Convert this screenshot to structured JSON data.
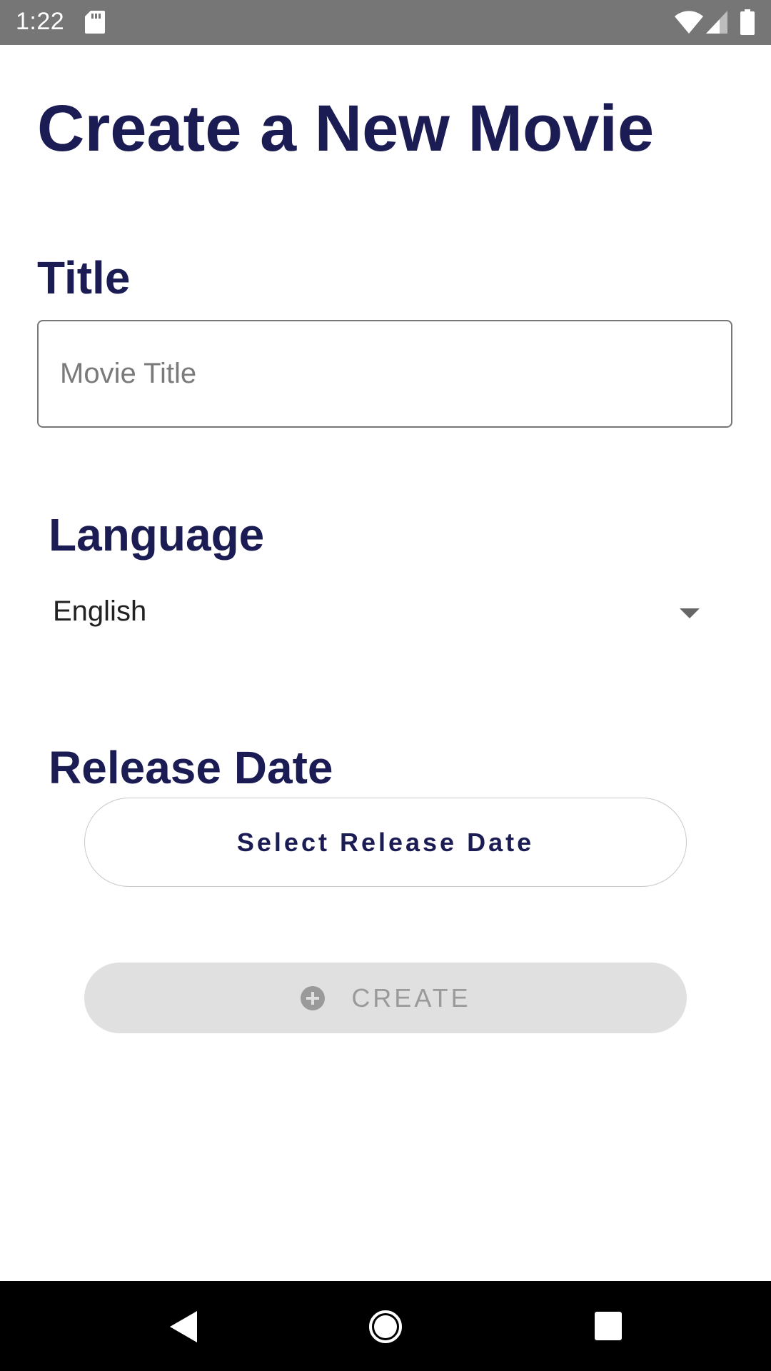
{
  "status_bar": {
    "time": "1:22",
    "icons": [
      "sd-card-icon",
      "wifi-icon",
      "cell-signal-icon",
      "battery-icon"
    ]
  },
  "page": {
    "title": "Create a New Movie"
  },
  "title_field": {
    "label": "Title",
    "placeholder": "Movie Title",
    "value": ""
  },
  "language_field": {
    "label": "Language",
    "selected": "English"
  },
  "release_field": {
    "label": "Release Date",
    "button_label": "Select Release Date"
  },
  "create_button": {
    "label": "CREATE",
    "icon": "add-circle-icon",
    "enabled": false
  },
  "navigation_bar": {
    "icons": [
      "back-icon",
      "home-icon",
      "recents-icon"
    ]
  },
  "colors": {
    "heading": "#1c1c54",
    "status_bar": "#767676",
    "disabled_button": "#e0e0e0",
    "disabled_text": "#9a9a9a"
  }
}
